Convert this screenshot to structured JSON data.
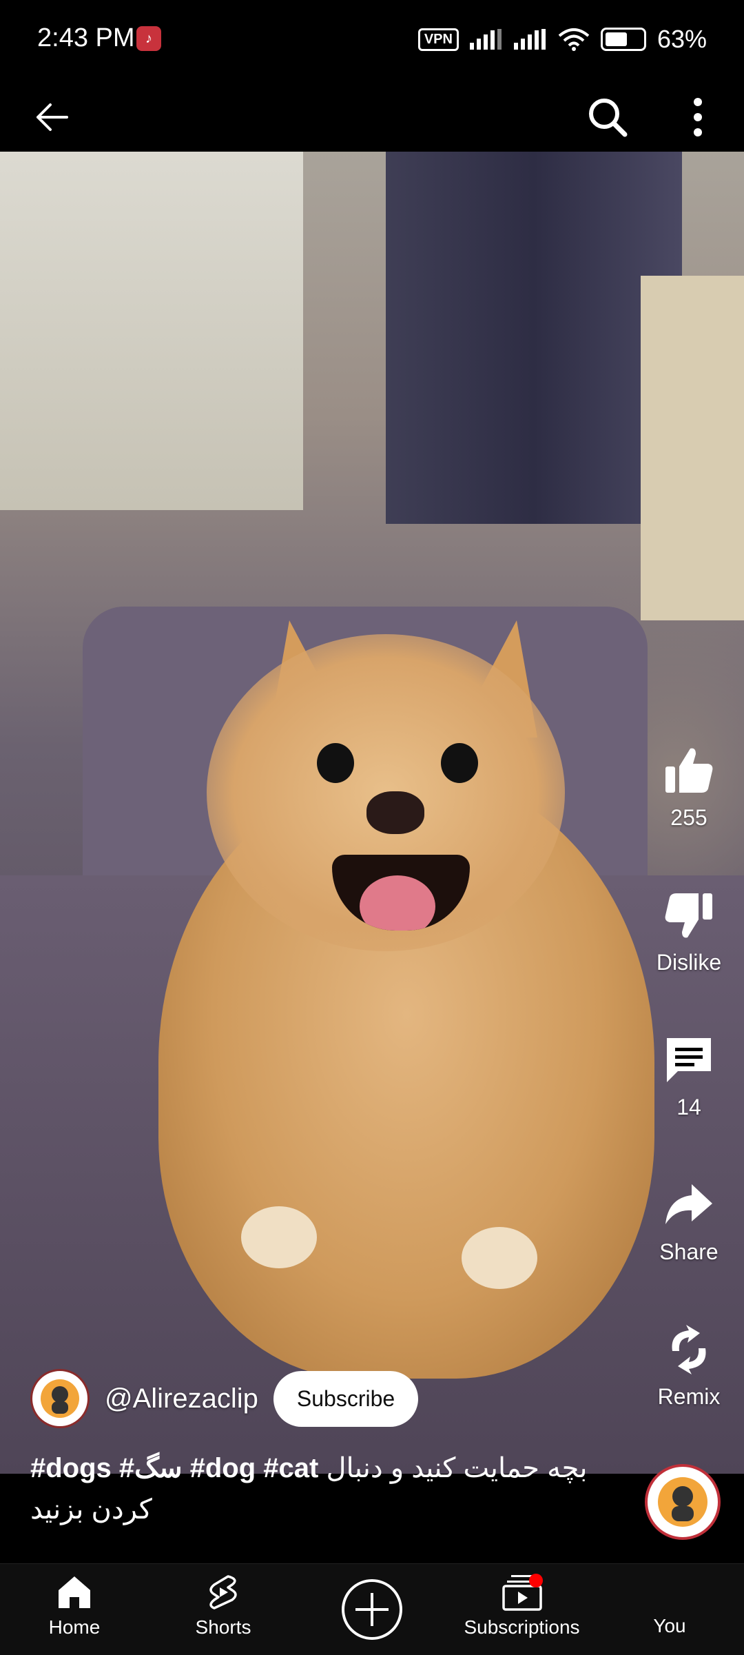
{
  "status_bar": {
    "time": "2:43 PM",
    "vpn": "VPN",
    "battery": "63%",
    "battery_level": 0.63
  },
  "app_bar": {
    "back_icon": "arrow-left-icon",
    "search_icon": "search-icon",
    "menu_icon": "more-vert-icon"
  },
  "actions": {
    "like_count": "255",
    "dislike_label": "Dislike",
    "comment_count": "14",
    "share_label": "Share",
    "remix_label": "Remix"
  },
  "channel": {
    "handle": "@Alirezaclip",
    "subscribe_label": "Subscribe"
  },
  "caption": {
    "hashtags_1": "#dogs #سگ #dog #cat",
    "persian_text": "بچه حمایت کنید و دنبال کردن بزنید"
  },
  "bottom_nav": {
    "home": "Home",
    "shorts": "Shorts",
    "subscriptions": "Subscriptions",
    "you": "You"
  },
  "colors": {
    "accent": "#ff0000",
    "background": "#000000",
    "nav_background": "#0f0f0f"
  }
}
